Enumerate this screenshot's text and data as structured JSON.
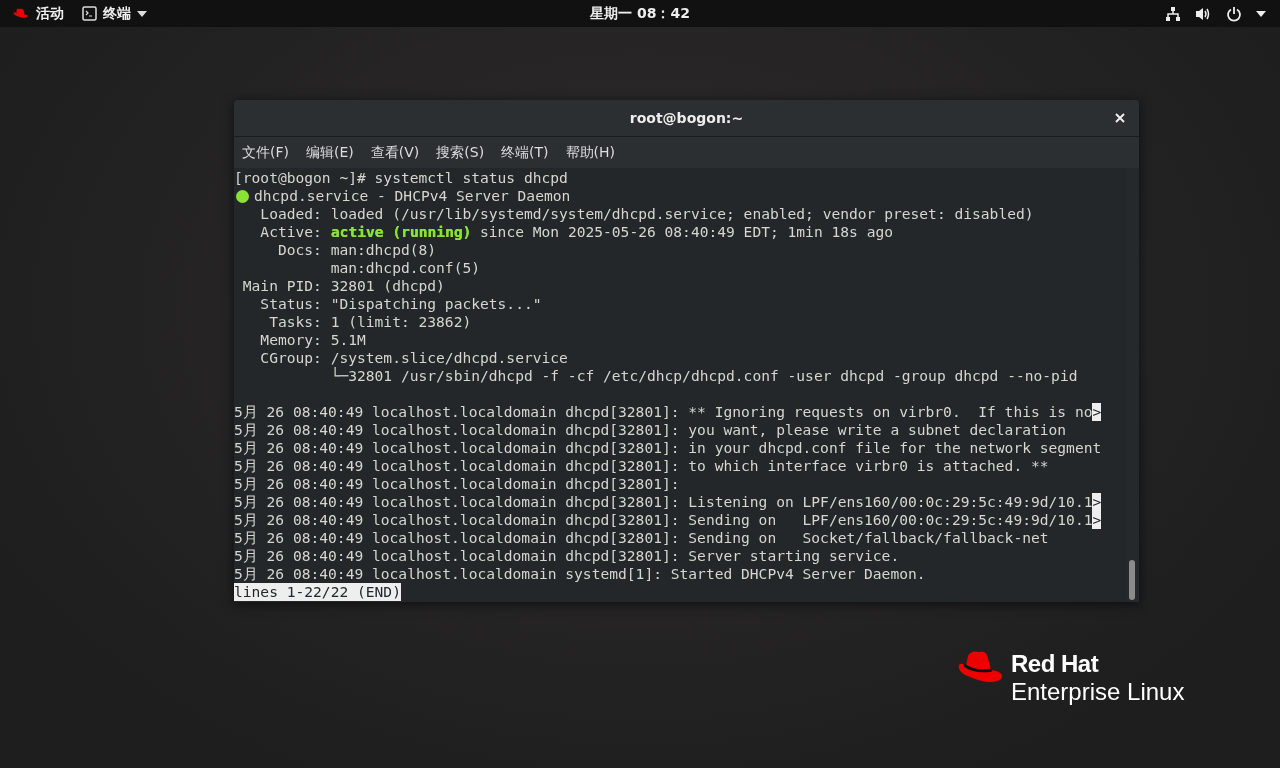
{
  "top_bar": {
    "activities": "活动",
    "app_menu": "终端",
    "clock": "星期一 08：42"
  },
  "window": {
    "title": "root@bogon:~",
    "menu": [
      "文件(F)",
      "编辑(E)",
      "查看(V)",
      "搜索(S)",
      "终端(T)",
      "帮助(H)"
    ],
    "status_lines": [
      {
        "kind": "plain",
        "segments": [
          {
            "kind": "text",
            "text": "[root@bogon ~]# systemctl status dhcpd"
          }
        ]
      },
      {
        "kind": "bullet",
        "segments": [
          {
            "kind": "text",
            "text": "dhcpd.service - DHCPv4 Server Daemon"
          }
        ]
      },
      {
        "kind": "plain",
        "segments": [
          {
            "kind": "text",
            "text": "   Loaded: loaded (/usr/lib/systemd/system/dhcpd.service; enabled; vendor preset: disabled)"
          }
        ]
      },
      {
        "kind": "plain",
        "segments": [
          {
            "kind": "text",
            "text": "   Active: "
          },
          {
            "kind": "status",
            "text": "active (running)"
          },
          {
            "kind": "text",
            "text": " since Mon 2025-05-26 08:40:49 EDT; 1min 18s ago"
          }
        ]
      },
      {
        "kind": "plain",
        "segments": [
          {
            "kind": "text",
            "text": "     Docs: man:dhcpd(8)"
          }
        ]
      },
      {
        "kind": "plain",
        "segments": [
          {
            "kind": "text",
            "text": "           man:dhcpd.conf(5)"
          }
        ]
      },
      {
        "kind": "plain",
        "segments": [
          {
            "kind": "text",
            "text": " Main PID: 32801 (dhcpd)"
          }
        ]
      },
      {
        "kind": "plain",
        "segments": [
          {
            "kind": "text",
            "text": "   Status: \"Dispatching packets...\""
          }
        ]
      },
      {
        "kind": "plain",
        "segments": [
          {
            "kind": "text",
            "text": "    Tasks: 1 (limit: 23862)"
          }
        ]
      },
      {
        "kind": "plain",
        "segments": [
          {
            "kind": "text",
            "text": "   Memory: 5.1M"
          }
        ]
      },
      {
        "kind": "plain",
        "segments": [
          {
            "kind": "text",
            "text": "   CGroup: /system.slice/dhcpd.service"
          }
        ]
      },
      {
        "kind": "plain",
        "segments": [
          {
            "kind": "text",
            "text": "           └─32801 /usr/sbin/dhcpd -f -cf /etc/dhcp/dhcpd.conf -user dhcpd -group dhcpd --no-pid"
          }
        ]
      }
    ],
    "log_lines": [
      {
        "segments": [
          {
            "kind": "text",
            "text": "5月 26 08:40:49 localhost.localdomain dhcpd[32801]: ** Ignoring requests on virbr0.  If this is no"
          },
          {
            "kind": "overflow",
            "text": ">"
          }
        ]
      },
      {
        "segments": [
          {
            "kind": "text",
            "text": "5月 26 08:40:49 localhost.localdomain dhcpd[32801]: you want, please write a subnet declaration"
          }
        ]
      },
      {
        "segments": [
          {
            "kind": "text",
            "text": "5月 26 08:40:49 localhost.localdomain dhcpd[32801]: in your dhcpd.conf file for the network segment"
          }
        ]
      },
      {
        "segments": [
          {
            "kind": "text",
            "text": "5月 26 08:40:49 localhost.localdomain dhcpd[32801]: to which interface virbr0 is attached. **"
          }
        ]
      },
      {
        "segments": [
          {
            "kind": "text",
            "text": "5月 26 08:40:49 localhost.localdomain dhcpd[32801]:"
          }
        ]
      },
      {
        "segments": [
          {
            "kind": "text",
            "text": "5月 26 08:40:49 localhost.localdomain dhcpd[32801]: Listening on LPF/ens160/00:0c:29:5c:49:9d/10.1"
          },
          {
            "kind": "overflow",
            "text": ">"
          }
        ]
      },
      {
        "segments": [
          {
            "kind": "text",
            "text": "5月 26 08:40:49 localhost.localdomain dhcpd[32801]: Sending on   LPF/ens160/00:0c:29:5c:49:9d/10.1"
          },
          {
            "kind": "overflow",
            "text": ">"
          }
        ]
      },
      {
        "segments": [
          {
            "kind": "text",
            "text": "5月 26 08:40:49 localhost.localdomain dhcpd[32801]: Sending on   Socket/fallback/fallback-net"
          }
        ]
      },
      {
        "segments": [
          {
            "kind": "text",
            "text": "5月 26 08:40:49 localhost.localdomain dhcpd[32801]: Server starting service."
          }
        ]
      },
      {
        "segments": [
          {
            "kind": "text",
            "text": "5月 26 08:40:49 localhost.localdomain systemd[1]: Started DHCPv4 Server Daemon."
          }
        ]
      }
    ],
    "pager_status": "lines 1-22/22 (END)"
  },
  "logo": {
    "line_1": "Red Hat",
    "line_2": "Enterprise Linux"
  }
}
